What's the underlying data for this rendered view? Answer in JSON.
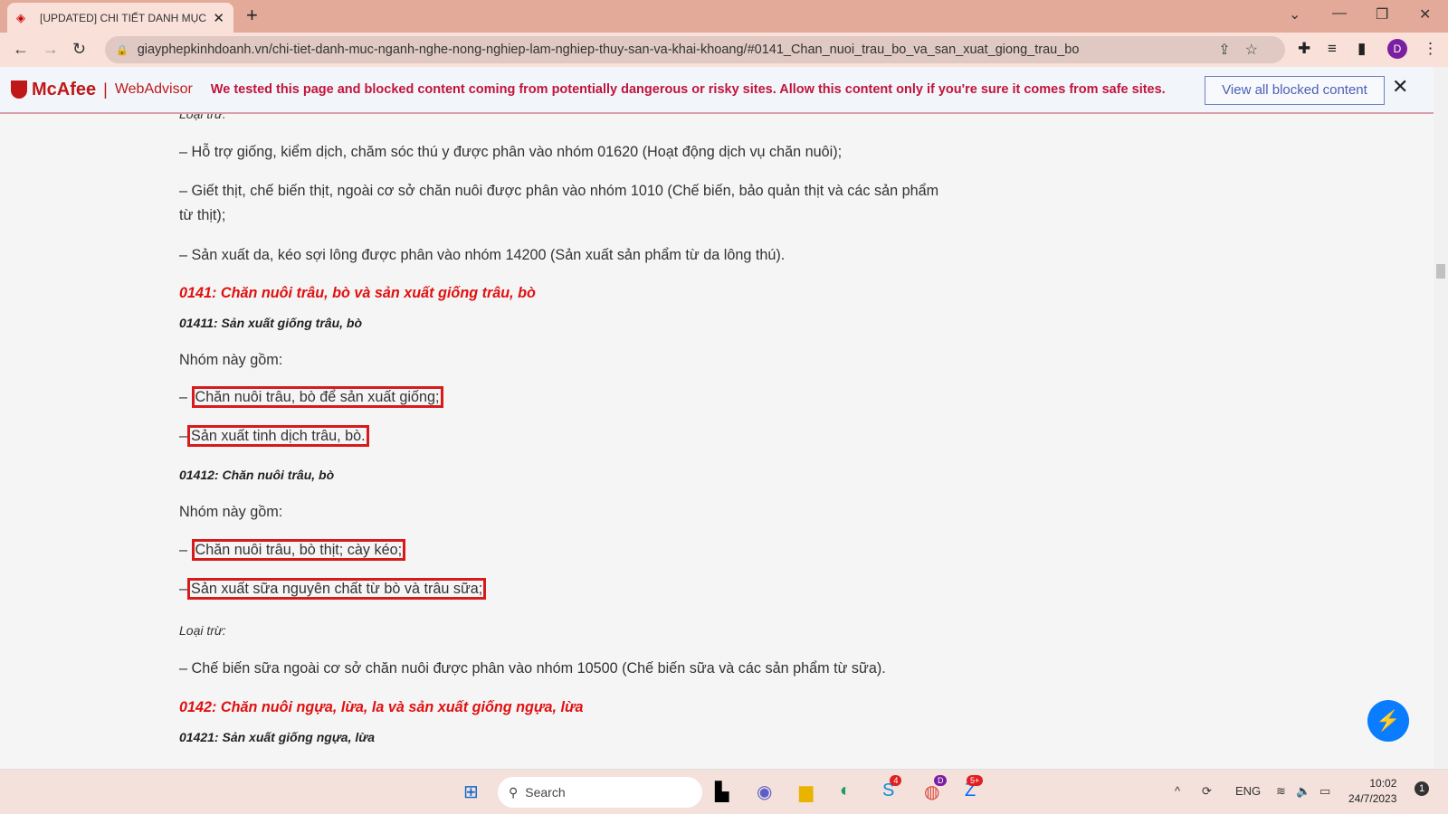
{
  "browser": {
    "tab_title": "[UPDATED] CHI TIẾT DANH MỤC",
    "url": "giayphepkinhdoanh.vn/chi-tiet-danh-muc-nganh-nghe-nong-nghiep-lam-nghiep-thuy-san-va-khai-khoang/#0141_Chan_nuoi_trau_bo_va_san_xuat_giong_trau_bo",
    "avatar_letter": "D"
  },
  "mcafee": {
    "brand": "McAfee",
    "product": "WebAdvisor",
    "message": "We tested this page and blocked content coming from potentially dangerous or risky sites. Allow this content only if you're sure it comes from safe sites.",
    "button": "View all blocked content"
  },
  "content": {
    "p0": "Loại trừ:",
    "p1": "– Hỗ trợ giống, kiểm dịch, chăm sóc thú y được phân vào nhóm 01620 (Hoạt động dịch vụ chăn nuôi);",
    "p2a": "– Giết thịt, chế biến thịt, ngoài cơ sở chăn nuôi được phân vào nhóm 1010 (Chế biến, bảo quản thịt và các sản phẩm",
    "p2b": "từ thịt);",
    "p3": "– Sản xuất da, kéo sợi lông được phân vào nhóm 14200 (Sản xuất sản phẩm từ da lông thú).",
    "h1": "0141: Chăn nuôi trâu, bò và sản xuất giống trâu, bò",
    "s1": "01411: Sản xuất giống trâu, bò",
    "n1": "Nhóm này gồm:",
    "b1": "Chăn nuôi trâu, bò để sản xuất giống;",
    "b2": "Sản xuất tinh dịch trâu, bò.",
    "s2": "01412: Chăn nuôi trâu, bò",
    "n2": "Nhóm này gồm:",
    "b3": "Chăn nuôi trâu, bò thịt; cày kéo;",
    "b4": "Sản xuất sữa nguyên chất từ bò và trâu sữa;",
    "l2": "Loại trừ:",
    "p4": "– Chế biến sữa ngoài cơ sở chăn nuôi được phân vào nhóm 10500 (Chế biến sữa và các sản phẩm từ sữa).",
    "h2": "0142: Chăn nuôi ngựa, lừa, la và sản xuất giống ngựa, lừa",
    "s3": "01421: Sản xuất giống ngựa, lừa",
    "dash": "–"
  },
  "taskbar": {
    "search": "Search",
    "skype_badge": "4",
    "chrome_badge": "D",
    "zalo_badge": "5+",
    "lang": "ENG",
    "time": "10:02",
    "date": "24/7/2023",
    "notif": "1"
  },
  "colors": {
    "heading": "#e01010",
    "highlight_box": "#d81a1a",
    "mcafee": "#c01818"
  }
}
